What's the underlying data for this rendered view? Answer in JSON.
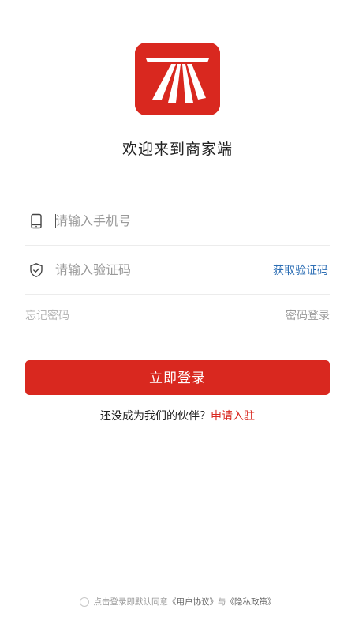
{
  "brand": {
    "logo_color": "#d9281f",
    "welcome_text": "欢迎来到商家端"
  },
  "form": {
    "phone": {
      "icon": "phone-icon",
      "value": "",
      "placeholder": "请输入手机号"
    },
    "code": {
      "icon": "shield-check-icon",
      "value": "",
      "placeholder": "请输入验证码",
      "get_code_label": "获取验证码"
    },
    "forgot_password": "忘记密码",
    "password_login": "密码登录",
    "login_button": "立即登录"
  },
  "partner": {
    "prompt": "还没成为我们的伙伴？",
    "apply_link": "申请入驻"
  },
  "agreement": {
    "checked": false,
    "prefix": "点击登录即默认同意",
    "user_agreement": "《用户协议》",
    "conjunction": "与",
    "privacy_policy": "《隐私政策》"
  },
  "colors": {
    "accent": "#d9281f",
    "link_blue": "#2e6fb5"
  }
}
